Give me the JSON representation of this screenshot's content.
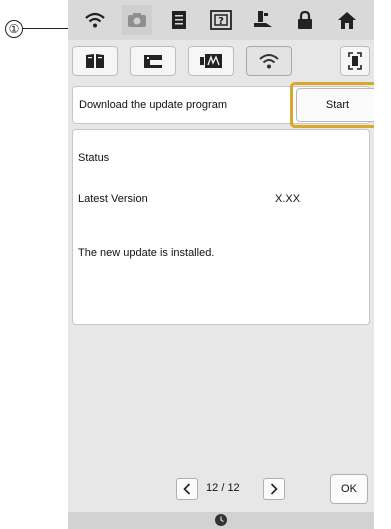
{
  "callout": {
    "number": "①"
  },
  "top_bar": {
    "icons": [
      "wifi-icon",
      "camera-icon",
      "document-icon",
      "help-icon",
      "presser-foot-icon",
      "lock-icon",
      "home-icon"
    ]
  },
  "sub_tabs": [
    "book-icon",
    "sewing-machine-icon",
    "embroidery-icon",
    "wifi-icon",
    "screen-capture-icon"
  ],
  "download": {
    "label": "Download the update program",
    "start_label": "Start"
  },
  "status": {
    "heading": "Status",
    "latest_version_label": "Latest Version",
    "latest_version_value": "X.XX",
    "message": "The new update is installed."
  },
  "pagination": {
    "current": "12",
    "separator": "/",
    "total": "12",
    "ok_label": "OK"
  },
  "colors": {
    "highlight": "#d6a92c",
    "screen_bg": "#e7e7e7"
  }
}
